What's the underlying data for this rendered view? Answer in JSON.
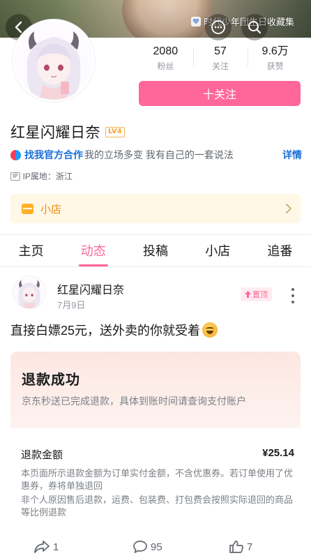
{
  "banner": {
    "label": "时代少年团生日收藏集"
  },
  "profile": {
    "stats": [
      {
        "num": "2080",
        "label": "粉丝"
      },
      {
        "num": "57",
        "label": "关注"
      },
      {
        "num": "9.6万",
        "label": "获赞"
      }
    ],
    "follow_label": "十关注",
    "name": "红星闪耀日奈",
    "level": "LV4",
    "bio_link": "找我官方合作",
    "bio_text": "我的立场多变 我有自己的一套说法",
    "bio_detail": "详情",
    "ip_icon": "IP",
    "ip_text": "IP属地：浙江",
    "shop_label": "小店"
  },
  "tabs": [
    {
      "label": "主页",
      "active": false
    },
    {
      "label": "动态",
      "active": true
    },
    {
      "label": "投稿",
      "active": false
    },
    {
      "label": "小店",
      "active": false
    },
    {
      "label": "追番",
      "active": false
    }
  ],
  "post": {
    "author": "红星闪耀日奈",
    "date": "7月9日",
    "pin_label": "置顶",
    "text": "直接白嫖25元，送外卖的你就受着",
    "refund": {
      "title": "退款成功",
      "desc": "京东秒送已完成退款，具体到账时间请查询支付账户",
      "amount_label": "退款金额",
      "amount_value": "¥25.14",
      "note1": "本页面所示退款金额为订单实付金额，不含优惠券。若订单使用了优惠券，券将单独退回",
      "note2": "非个人原因售后退款，运费、包装费、打包费会按照实际退回的商品等比例退款"
    },
    "actions": {
      "share_count": "1",
      "comment_count": "95",
      "like_count": "7"
    }
  },
  "colors": {
    "accent_pink": "#ff6699",
    "link_blue": "#1a6fd6",
    "shop_orange": "#f08a0c"
  }
}
